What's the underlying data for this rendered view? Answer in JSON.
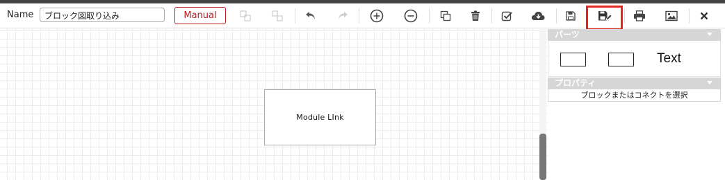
{
  "toolbar": {
    "name_label": "Name",
    "name_value": "ブロック図取り込み",
    "manual_label": "Manual",
    "icons": [
      "group-icon",
      "ungroup-icon",
      "undo-icon",
      "redo-icon",
      "zoom-in-icon",
      "zoom-out-icon",
      "copy-icon",
      "trash-icon",
      "check-icon",
      "cloud-download-icon",
      "save-icon",
      "save-edit-icon",
      "print-icon",
      "image-icon",
      "close-icon"
    ],
    "highlight_color": "#e8261c"
  },
  "canvas": {
    "module_label": "Module LInk"
  },
  "panel": {
    "parts_title": "パーツ",
    "parts": {
      "text_label": "Text"
    },
    "properties_title": "プロパティ",
    "properties_placeholder": "ブロックまたはコネクトを選択"
  },
  "colors": {
    "accent_red": "#c0161d",
    "section_header": "#d6d6d6"
  }
}
